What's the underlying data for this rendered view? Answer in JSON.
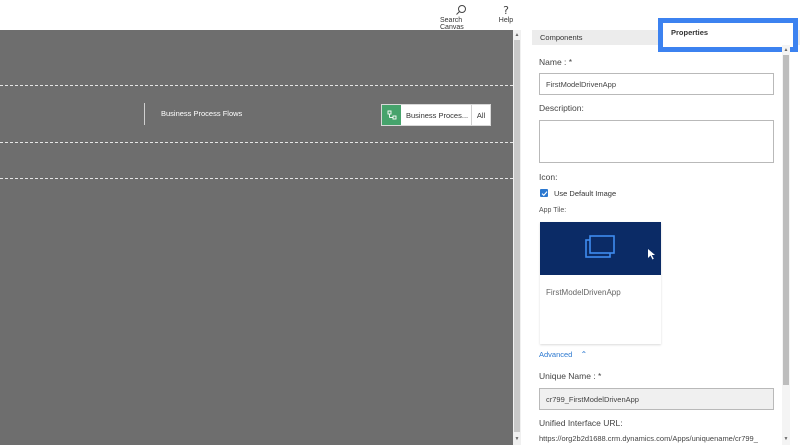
{
  "toolbar": {
    "search_canvas_label": "Search Canvas",
    "search_icon": "search-icon",
    "help_label": "Help",
    "help_icon": "question-mark-icon"
  },
  "canvas": {
    "row_title": "Business Process Flows",
    "pill_label": "Business Proces...",
    "pill_all": "All",
    "pill_icon": "process-flow-icon",
    "pill_icon_color": "#46a36c",
    "background_color": "#6e6e6e"
  },
  "panel": {
    "tabs": [
      {
        "label": "Components"
      },
      {
        "label": "Properties"
      }
    ],
    "name_label": "Name : *",
    "name_value": "FirstModelDrivenApp",
    "description_label": "Description:",
    "description_value": "",
    "icon_label": "Icon:",
    "use_default_image_label": "Use Default Image",
    "use_default_image_checked": true,
    "app_tile_label": "App Tile:",
    "tile_name": "FirstModelDrivenApp",
    "tile_icon": "app-tile-icon",
    "tile_color": "#0b2b66",
    "advanced_label": "Advanced",
    "unique_name_label": "Unique Name : *",
    "unique_name_value": "cr799_FirstModelDrivenApp",
    "unified_url_label": "Unified Interface URL:",
    "unified_url_value": "https://org2b2d1688.crm.dynamics.com/Apps/uniquename/cr799_",
    "accent_color": "#3c82f0"
  }
}
